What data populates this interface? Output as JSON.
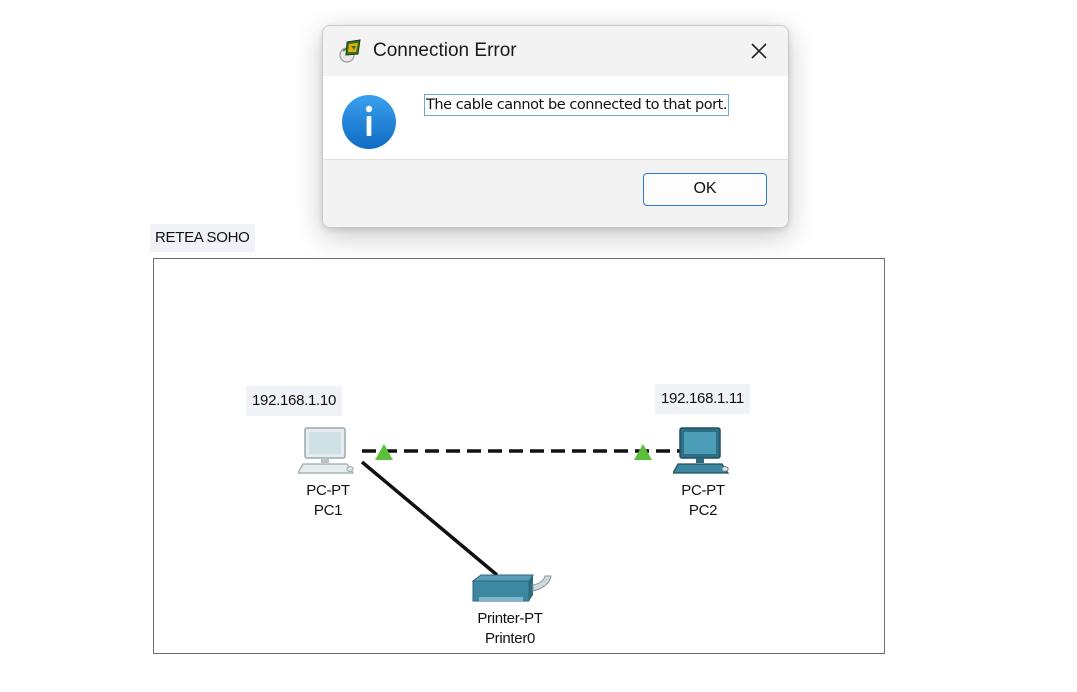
{
  "dialog": {
    "title": "Connection Error",
    "message": "The cable cannot be connected to that port.",
    "ok_label": "OK",
    "icons": {
      "app": "packet-tracer-app-icon",
      "close": "close-icon",
      "info": "info-icon"
    },
    "info_color": "#1a7fd6"
  },
  "workspace": {
    "area_label": "RETEA SOHO",
    "devices": [
      {
        "ip": "192.168.1.10",
        "type": "PC-PT",
        "name": "PC1",
        "icon": "pc-icon"
      },
      {
        "ip": "192.168.1.11",
        "type": "PC-PT",
        "name": "PC2",
        "icon": "pc-icon"
      },
      {
        "type": "Printer-PT",
        "name": "Printer0",
        "icon": "printer-icon"
      }
    ],
    "links": [
      {
        "from": "PC1",
        "to": "PC2",
        "style": "dashed",
        "status": "up"
      },
      {
        "from": "PC1",
        "to": "Printer0",
        "style": "solid"
      }
    ],
    "link_up_color": "#5cbf3c"
  }
}
